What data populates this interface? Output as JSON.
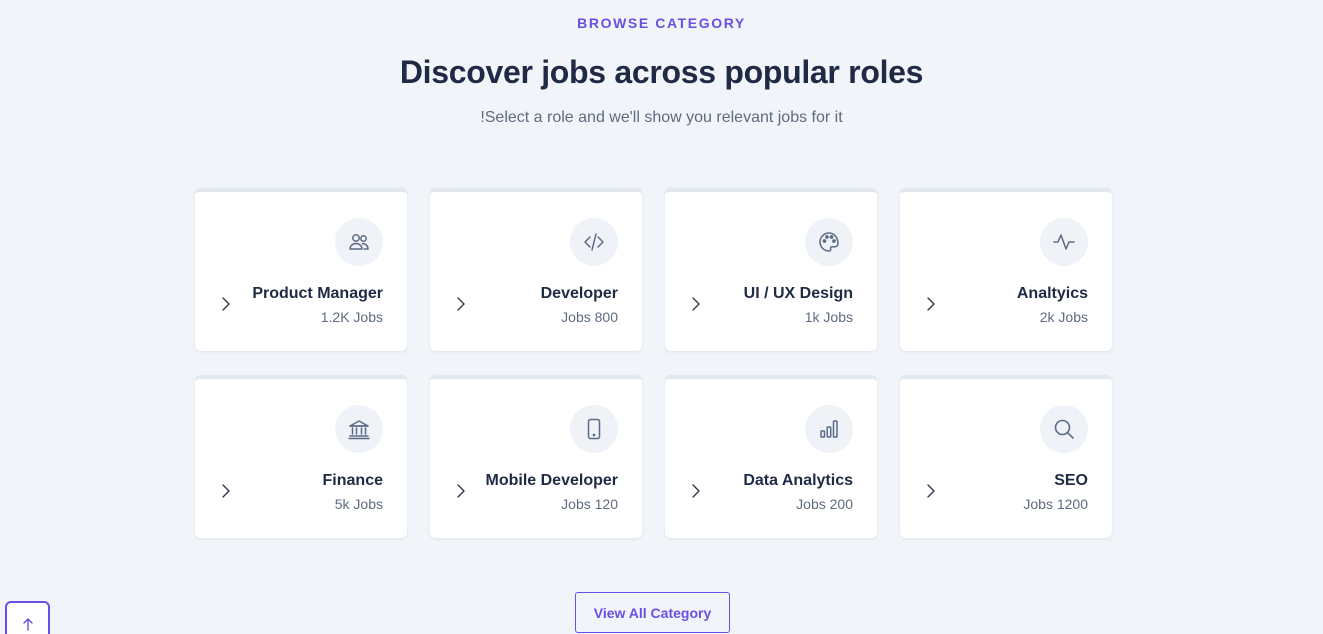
{
  "header": {
    "eyebrow": "BROWSE CATEGORY",
    "title": "Discover jobs across popular roles",
    "subtitle": "!Select a role and we'll show you relevant jobs for it"
  },
  "categories": [
    {
      "name": "Product Manager",
      "count": "1.2K Jobs",
      "icon": "users-icon"
    },
    {
      "name": "Developer",
      "count": "Jobs 800",
      "icon": "code-icon"
    },
    {
      "name": "UI / UX Design",
      "count": "1k Jobs",
      "icon": "palette-icon"
    },
    {
      "name": "Analtyics",
      "count": "2k Jobs",
      "icon": "activity-icon"
    },
    {
      "name": "Finance",
      "count": "5k Jobs",
      "icon": "bank-icon"
    },
    {
      "name": "Mobile Developer",
      "count": "Jobs 120",
      "icon": "smartphone-icon"
    },
    {
      "name": "Data Analytics",
      "count": "Jobs 200",
      "icon": "bar-chart-icon"
    },
    {
      "name": "SEO",
      "count": "Jobs 1200",
      "icon": "search-icon"
    }
  ],
  "footer": {
    "view_all_label": "View All Category",
    "scroll_top_icon": "arrow-up-icon"
  },
  "colors": {
    "accent": "#6b4fe0",
    "background": "#f1f4f9",
    "card": "#ffffff",
    "icon_bg": "#eff2f7",
    "heading": "#1f2a44",
    "muted": "#5f6b7e"
  }
}
